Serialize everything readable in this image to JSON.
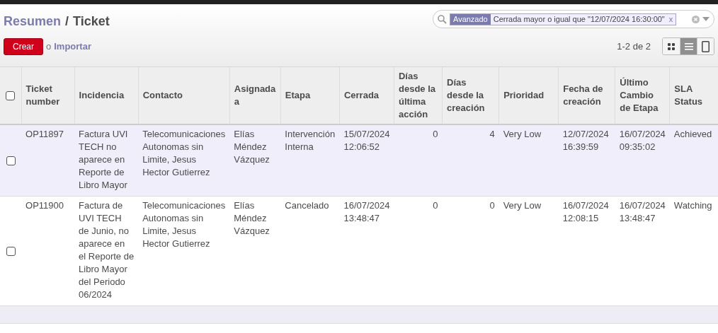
{
  "breadcrumb": {
    "parent": "Resumen",
    "separator": "/",
    "current": "Ticket"
  },
  "search": {
    "facet_label": "Avanzado",
    "facet_value": "Cerrada mayor o igual que \"12/07/2024 16:30:00\"",
    "facet_remove": "x"
  },
  "buttons": {
    "create": "Crear",
    "or": "o",
    "import": "Importar"
  },
  "pager": "1-2 de 2",
  "view_switcher": [
    {
      "kind": "kanban",
      "selected": false
    },
    {
      "kind": "list",
      "selected": true
    },
    {
      "kind": "form",
      "selected": false
    }
  ],
  "table": {
    "select_all_checked": false,
    "columns": [
      "Ticket number",
      "Incidencia",
      "Contacto",
      "Asignada a",
      "Etapa",
      "Cerrada",
      "Días desde la última acción",
      "Días desde la creación",
      "Prioridad",
      "Fecha de creación",
      "Último Cambio de Etapa",
      "SLA Status"
    ],
    "rows": [
      {
        "selected": true,
        "checked": false,
        "cells": [
          "OP11897",
          "Factura UVI TECH no aparece en Reporte de Libro Mayor",
          "Telecomunicaciones Autonomas sin Limite, Jesus Hector Gutierrez",
          "Elías Méndez Vázquez",
          "Intervención Interna",
          "15/07/2024 12:06:52",
          "0",
          "4",
          "Very Low",
          "12/07/2024 16:39:59",
          "16/07/2024 09:35:02",
          "Achieved"
        ]
      },
      {
        "selected": false,
        "checked": false,
        "cells": [
          "OP11900",
          "Factura de UVI TECH de Junio, no aparece en el Reporte de Libro Mayor del Periodo 06/2024",
          "Telecomunicaciones Autonomas sin Limite, Jesus Hector Gutierrez",
          "Elías Méndez Vázquez",
          "Cancelado",
          "16/07/2024 13:48:47",
          "0",
          "0",
          "Very Low",
          "16/07/2024 12:08:15",
          "16/07/2024 13:48:47",
          "Watching"
        ]
      }
    ]
  }
}
